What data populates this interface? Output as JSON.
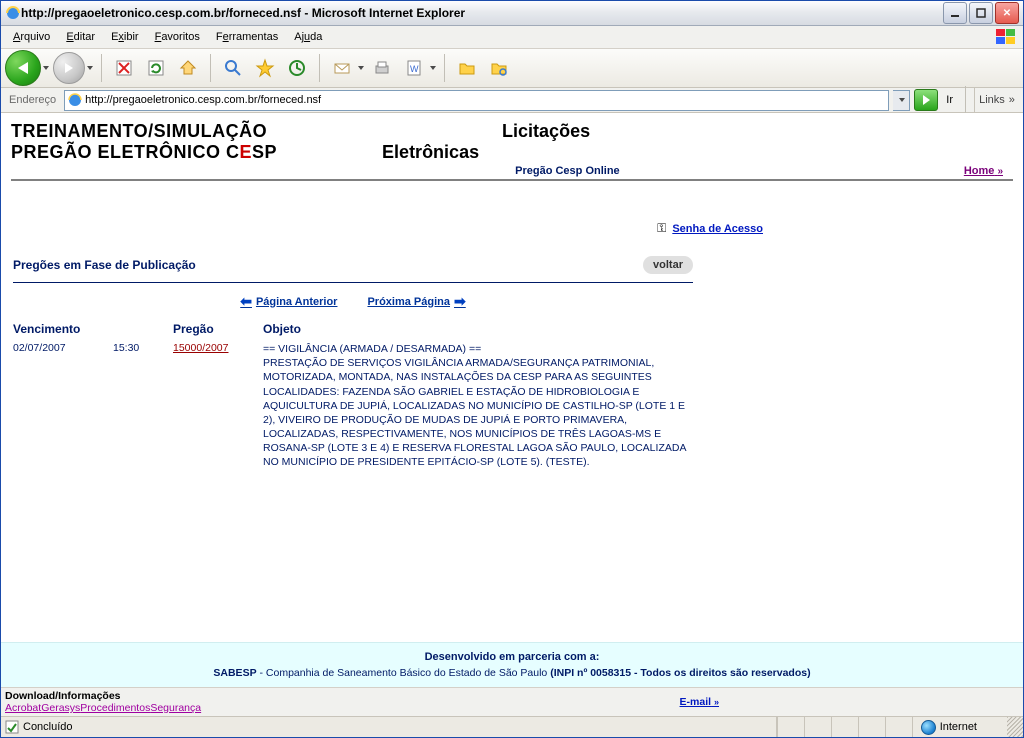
{
  "window": {
    "title": "http://pregaoeletronico.cesp.com.br/forneced.nsf - Microsoft Internet Explorer"
  },
  "menubar": {
    "arquivo": "Arquivo",
    "editar": "Editar",
    "exibir": "Exibir",
    "favoritos": "Favoritos",
    "ferramentas": "Ferramentas",
    "ajuda": "Ajuda"
  },
  "addressbar": {
    "label": "Endereço",
    "url": "http://pregaoeletronico.cesp.com.br/forneced.nsf",
    "go": "Ir",
    "links": "Links"
  },
  "header": {
    "line1": "TREINAMENTO/SIMULAÇÃO",
    "line2_pre": "PREGÃO ELETRÔNICO C",
    "line2_e": "E",
    "line2_post": "SP",
    "right1": "Licitações",
    "right2": "Eletrônicas",
    "sub": "Pregão Cesp Online",
    "home": "Home"
  },
  "senha": {
    "label": "Senha de Acesso"
  },
  "main": {
    "section_title": "Pregões em Fase de Publicação",
    "voltar": "voltar",
    "pager_prev": "Página Anterior",
    "pager_next": "Próxima Página",
    "cols": {
      "venc": "Vencimento",
      "preg": "Pregão",
      "obj": "Objeto"
    },
    "rows": [
      {
        "venc": "02/07/2007",
        "time": "15:30",
        "pregao": "15000/2007",
        "objeto": "== VIGILÂNCIA (ARMADA / DESARMADA) ==\nPRESTAÇÃO DE SERVIÇOS VIGILÂNCIA ARMADA/SEGURANÇA PATRIMONIAL, MOTORIZADA, MONTADA, NAS INSTALAÇÕES DA CESP PARA AS SEGUINTES LOCALIDADES: FAZENDA SÃO GABRIEL E ESTAÇÃO DE HIDROBIOLOGIA E AQUICULTURA DE JUPIÁ, LOCALIZADAS NO MUNICÍPIO DE CASTILHO-SP (LOTE 1 E 2), VIVEIRO DE PRODUÇÃO DE MUDAS DE JUPIÁ E PORTO PRIMAVERA, LOCALIZADAS, RESPECTIVAMENTE, NOS MUNICÍPIOS DE TRÊS LAGOAS-MS E ROSANA-SP (LOTE 3 E 4) E RESERVA FLORESTAL LAGOA SÃO PAULO, LOCALIZADA NO MUNICÍPIO DE PRESIDENTE EPITÁCIO-SP (LOTE 5). (TESTE)."
      }
    ]
  },
  "footer": {
    "partner_l1": "Desenvolvido em parceria com a:",
    "sabesp": "SABESP",
    "partner_rest": " - Companhia de Saneamento Básico do Estado de São Paulo  ",
    "inpi": "(INPI nº 0058315 - Todos os direitos são reservados)",
    "dl_title": "Download/Informações",
    "links": {
      "acrobat": "Acrobat",
      "gerasys": "Gerasys",
      "proc": "Procedimentos",
      "seg": "Segurança"
    },
    "email": "E-mail"
  },
  "statusbar": {
    "done": "Concluído",
    "zone": "Internet"
  }
}
